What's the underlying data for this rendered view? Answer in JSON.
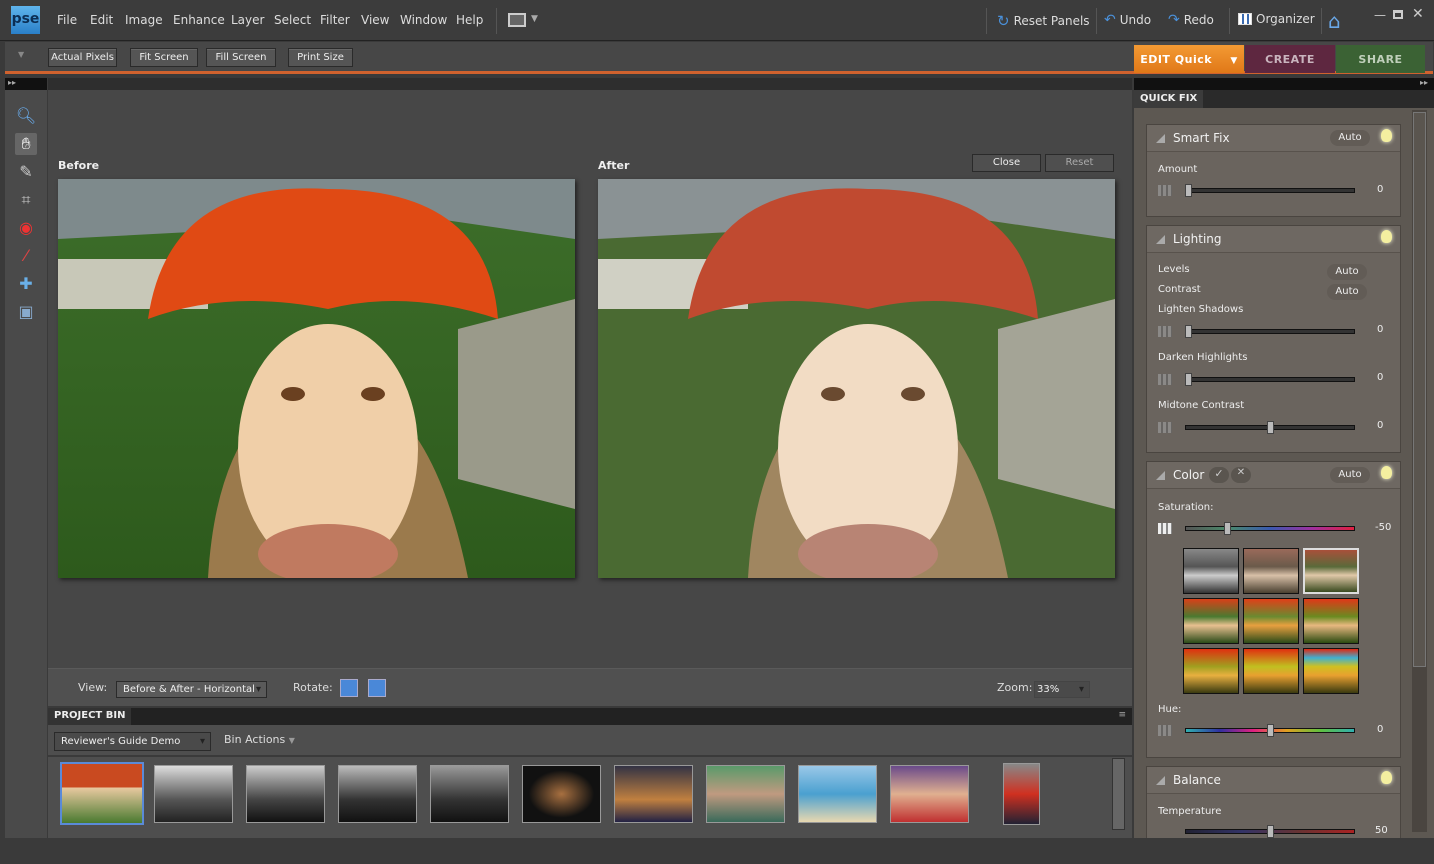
{
  "app": {
    "logo": "pse"
  },
  "menu": [
    "File",
    "Edit",
    "Image",
    "Enhance",
    "Layer",
    "Select",
    "Filter",
    "View",
    "Window",
    "Help"
  ],
  "toolbar": {
    "reset_panels": "Reset Panels",
    "undo": "Undo",
    "redo": "Redo",
    "organizer": "Organizer"
  },
  "options": {
    "buttons": [
      "Actual Pixels",
      "Fit Screen",
      "Fill Screen",
      "Print Size"
    ]
  },
  "modes": {
    "edit": "EDIT Quick",
    "create": "CREATE",
    "share": "SHARE",
    "colors": {
      "edit": "#ef8a24",
      "create": "#6a2a45",
      "share": "#3f6a37"
    }
  },
  "canvas": {
    "before_label": "Before",
    "after_label": "After",
    "close": "Close",
    "reset": "Reset"
  },
  "viewbar": {
    "view_label": "View:",
    "view_value": "Before & After - Horizontal",
    "rotate_label": "Rotate:",
    "zoom_label": "Zoom:",
    "zoom_value": "33%"
  },
  "bin": {
    "title": "PROJECT BIN",
    "album": "Reviewer's Guide Demo",
    "actions": "Bin Actions",
    "thumb_count": 11
  },
  "panel": {
    "tab": "QUICK FIX",
    "smartfix": {
      "title": "Smart Fix",
      "auto": "Auto",
      "amount_label": "Amount",
      "amount": "0"
    },
    "lighting": {
      "title": "Lighting",
      "levels": "Levels",
      "contrast": "Contrast",
      "auto": "Auto",
      "lighten_shadows": "Lighten Shadows",
      "lighten_value": "0",
      "darken_highlights": "Darken Highlights",
      "darken_value": "0",
      "midtone_contrast": "Midtone Contrast",
      "midtone_value": "0"
    },
    "color": {
      "title": "Color",
      "auto": "Auto",
      "saturation_label": "Saturation:",
      "saturation": "-50",
      "hue_label": "Hue:",
      "hue": "0"
    },
    "balance": {
      "title": "Balance",
      "temperature_label": "Temperature",
      "temperature": "50"
    }
  }
}
